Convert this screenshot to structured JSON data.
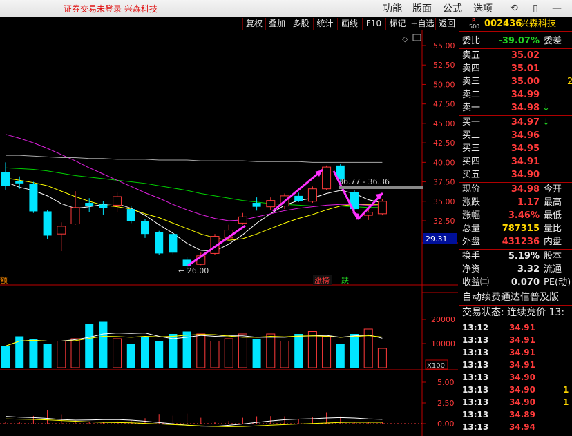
{
  "titlebar": {
    "login_status": "证券交易未登录  兴森科技",
    "menus": [
      "功能",
      "版面",
      "公式",
      "选项"
    ]
  },
  "toolbar": {
    "buttons": [
      "复权",
      "叠加",
      "多股",
      "统计",
      "画线",
      "F10",
      "标记",
      "+自选",
      "返回"
    ]
  },
  "chart": {
    "price_axis": [
      "55.00",
      "52.50",
      "50.00",
      "47.50",
      "45.00",
      "42.50",
      "40.00",
      "37.50",
      "35.00",
      "32.50"
    ],
    "current_price_tag": "29.31",
    "low_label": "← 26.00",
    "range_label": "36.77 - 36.36",
    "marker_left": "额",
    "marker_up": "涨榜",
    "marker_down": "跌",
    "volume_axis": [
      "20000",
      "10000"
    ],
    "volume_unit": "X100",
    "macd_axis": [
      "5.00",
      "2.50",
      "0.00"
    ],
    "colors": {
      "up": "#ff3a3a",
      "down": "#00e5ff",
      "annotation": "#ff30ff",
      "axis": "#c00000"
    }
  },
  "chart_data": {
    "type": "candlestick",
    "candles": [
      {
        "o": 38.7,
        "c": 37.0,
        "h": 40.0,
        "l": 36.5
      },
      {
        "o": 37.6,
        "c": 37.3,
        "h": 38.2,
        "l": 36.6
      },
      {
        "o": 37.2,
        "c": 33.7,
        "h": 37.5,
        "l": 33.5
      },
      {
        "o": 33.7,
        "c": 30.6,
        "h": 33.9,
        "l": 30.2
      },
      {
        "o": 30.8,
        "c": 31.8,
        "h": 32.3,
        "l": 28.6
      },
      {
        "o": 32.1,
        "c": 34.2,
        "h": 36.3,
        "l": 32.0
      },
      {
        "o": 34.8,
        "c": 34.4,
        "h": 35.4,
        "l": 33.6
      },
      {
        "o": 34.6,
        "c": 34.1,
        "h": 35.0,
        "l": 33.3
      },
      {
        "o": 34.5,
        "c": 35.6,
        "h": 36.1,
        "l": 33.6
      },
      {
        "o": 34.0,
        "c": 32.5,
        "h": 34.4,
        "l": 32.2
      },
      {
        "o": 32.5,
        "c": 30.8,
        "h": 32.7,
        "l": 30.3
      },
      {
        "o": 31.0,
        "c": 28.3,
        "h": 31.2,
        "l": 28.1
      },
      {
        "o": 30.8,
        "c": 28.4,
        "h": 31.0,
        "l": 28.2
      },
      {
        "o": 27.5,
        "c": 26.7,
        "h": 27.9,
        "l": 26.0
      },
      {
        "o": 26.9,
        "c": 28.0,
        "h": 28.4,
        "l": 26.8
      },
      {
        "o": 28.3,
        "c": 30.5,
        "h": 30.8,
        "l": 28.1
      },
      {
        "o": 30.3,
        "c": 31.3,
        "h": 32.0,
        "l": 30.0
      },
      {
        "o": 32.2,
        "c": 33.0,
        "h": 33.5,
        "l": 32.0
      },
      {
        "o": 34.8,
        "c": 34.3,
        "h": 35.5,
        "l": 33.8
      },
      {
        "o": 34.3,
        "c": 35.1,
        "h": 35.5,
        "l": 33.9
      },
      {
        "o": 34.4,
        "c": 35.7,
        "h": 36.0,
        "l": 34.0
      },
      {
        "o": 35.7,
        "c": 35.0,
        "h": 36.1,
        "l": 34.9
      },
      {
        "o": 35.0,
        "c": 36.6,
        "h": 36.9,
        "l": 34.8
      },
      {
        "o": 36.6,
        "c": 39.4,
        "h": 39.6,
        "l": 36.4
      },
      {
        "o": 39.6,
        "c": 37.8,
        "h": 39.8,
        "l": 37.0
      },
      {
        "o": 36.2,
        "c": 34.0,
        "h": 36.4,
        "l": 33.2
      },
      {
        "o": 33.2,
        "c": 33.6,
        "h": 34.2,
        "l": 32.6
      },
      {
        "o": 33.4,
        "c": 35.0,
        "h": 35.3,
        "l": 33.2
      }
    ],
    "ma": [
      {
        "color": "#ffffff",
        "values": [
          37.5,
          36.8,
          36.4,
          35.7,
          34.7,
          34.1,
          34.3,
          34.6,
          34.7,
          34.1,
          33.2,
          32.0,
          30.9,
          29.6,
          28.7,
          28.6,
          29.5,
          30.7,
          32.2,
          33.4,
          34.5,
          35.1,
          35.4,
          36.0,
          36.4,
          36.0,
          35.2,
          34.8
        ]
      },
      {
        "color": "#ffff00",
        "values": [
          38.0,
          37.7,
          37.4,
          37.0,
          36.3,
          35.6,
          35.0,
          34.5,
          34.3,
          34.0,
          33.4,
          32.9,
          32.2,
          31.5,
          30.8,
          30.3,
          30.0,
          30.2,
          30.8,
          31.5,
          32.2,
          32.8,
          33.3,
          33.9,
          34.4,
          34.6,
          34.6,
          34.6
        ]
      },
      {
        "color": "#00d000",
        "values": [
          39.3,
          39.2,
          39.1,
          38.9,
          38.6,
          38.3,
          38.1,
          37.9,
          37.7,
          37.5,
          37.3,
          37.0,
          36.7,
          36.4,
          36.0,
          35.7,
          35.4,
          35.1,
          34.9,
          34.7,
          34.6,
          34.5,
          34.4,
          34.4,
          34.4,
          34.3,
          34.2,
          34.2
        ]
      },
      {
        "color": "#e020e0",
        "values": [
          43.6,
          43.1,
          42.5,
          41.8,
          41.0,
          40.2,
          39.3,
          38.5,
          37.7,
          36.9,
          36.1,
          35.4,
          34.6,
          33.9,
          33.3,
          32.8,
          32.5,
          32.6,
          33.0,
          33.4,
          33.8,
          34.1,
          34.3,
          34.5,
          34.6,
          34.6,
          34.5,
          34.4
        ]
      },
      {
        "color": "#a8a8a8",
        "values": [
          40.9,
          40.9,
          40.8,
          40.7,
          40.6,
          40.6,
          40.5,
          40.5,
          40.4,
          40.4,
          40.4,
          40.3,
          40.3,
          40.3,
          40.2,
          40.2,
          40.2,
          40.2,
          40.1,
          40.1,
          40.1,
          40.1,
          40.0,
          40.0,
          40.0,
          40.0,
          40.0,
          40.0
        ]
      }
    ],
    "volume": [
      9000,
      13000,
      12000,
      10000,
      11000,
      12000,
      18000,
      19000,
      12000,
      10000,
      13000,
      11000,
      14000,
      15000,
      14000,
      11000,
      12000,
      14000,
      12000,
      14000,
      11000,
      14000,
      15000,
      13000,
      10000,
      14000,
      16000,
      8000
    ],
    "ylim": [
      23,
      57
    ]
  },
  "panel": {
    "code_badge": "R",
    "code_badge_sub": "500",
    "code": "002436",
    "name": "兴森科技",
    "weibi_label": "委比",
    "weibi_value": "-39.07%",
    "weicha_label": "委差",
    "asks": [
      {
        "label": "卖五",
        "price": "35.02",
        "mark": ""
      },
      {
        "label": "卖四",
        "price": "35.01",
        "mark": ""
      },
      {
        "label": "卖三",
        "price": "35.00",
        "mark": "2"
      },
      {
        "label": "卖二",
        "price": "34.99",
        "mark": ""
      },
      {
        "label": "卖一",
        "price": "34.98",
        "mark": "↓"
      }
    ],
    "bids": [
      {
        "label": "买一",
        "price": "34.97",
        "mark": "↓"
      },
      {
        "label": "买二",
        "price": "34.96",
        "mark": ""
      },
      {
        "label": "买三",
        "price": "34.95",
        "mark": ""
      },
      {
        "label": "买四",
        "price": "34.91",
        "mark": ""
      },
      {
        "label": "买五",
        "price": "34.90",
        "mark": ""
      }
    ],
    "quote": [
      {
        "label": "现价",
        "value": "34.98",
        "tail": "今开",
        "vclass": "red"
      },
      {
        "label": "涨跌",
        "value": "1.17",
        "tail": "最高",
        "vclass": "red"
      },
      {
        "label": "涨幅",
        "value": "3.46%",
        "tail": "最低",
        "vclass": "red"
      },
      {
        "label": "总量",
        "value": "787315",
        "tail": "量比",
        "vclass": "yellow"
      },
      {
        "label": "外盘",
        "value": "431236",
        "tail": "内盘",
        "vclass": "red"
      }
    ],
    "fund": [
      {
        "label": "换手",
        "value": "5.19%",
        "tail": "股本"
      },
      {
        "label": "净资",
        "value": "3.32",
        "tail": "流通"
      },
      {
        "label": "收益㈡",
        "value": "0.070",
        "tail": "PE(动)"
      }
    ],
    "banner": "自动续费通达信普及版",
    "trade_status": "交易状态: 连续竞价 13:",
    "ticks": [
      {
        "time": "13:12",
        "price": "34.91",
        "vol": ""
      },
      {
        "time": "13:13",
        "price": "34.91",
        "vol": ""
      },
      {
        "time": "13:13",
        "price": "34.91",
        "vol": ""
      },
      {
        "time": "13:13",
        "price": "34.91",
        "vol": ""
      },
      {
        "time": "13:13",
        "price": "34.90",
        "vol": ""
      },
      {
        "time": "13:13",
        "price": "34.90",
        "vol": "1"
      },
      {
        "time": "13:13",
        "price": "34.90",
        "vol": "1"
      },
      {
        "time": "13:13",
        "price": "34.89",
        "vol": ""
      },
      {
        "time": "13:13",
        "price": "34.94",
        "vol": ""
      }
    ]
  }
}
